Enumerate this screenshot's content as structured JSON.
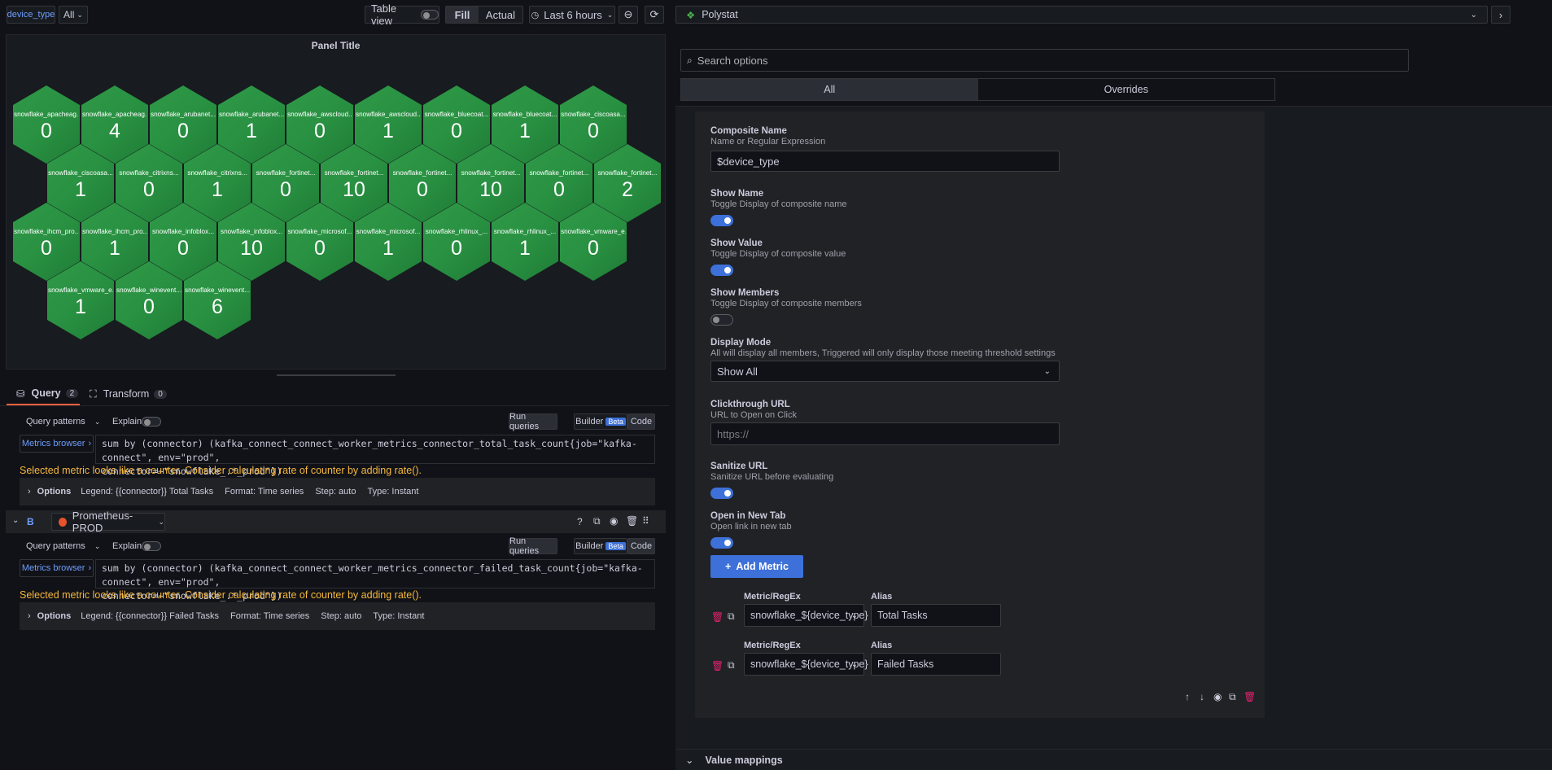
{
  "toolbar": {
    "var_label": "device_type",
    "var_value": "All",
    "table_view": "Table view",
    "fill": "Fill",
    "actual": "Actual",
    "time_range": "Last 6 hours"
  },
  "panel": {
    "title": "Panel Title"
  },
  "hexes": [
    {
      "name": "snowflake_apacheag...",
      "value": "0"
    },
    {
      "name": "snowflake_apacheag...",
      "value": "4"
    },
    {
      "name": "snowflake_arubanet...",
      "value": "0"
    },
    {
      "name": "snowflake_arubanet...",
      "value": "1"
    },
    {
      "name": "snowflake_awscloud...",
      "value": "0"
    },
    {
      "name": "snowflake_awscloud...",
      "value": "1"
    },
    {
      "name": "snowflake_bluecoat...",
      "value": "0"
    },
    {
      "name": "snowflake_bluecoat...",
      "value": "1"
    },
    {
      "name": "snowflake_ciscoasa...",
      "value": "0"
    },
    {
      "name": "snowflake_ciscoasa...",
      "value": "1"
    },
    {
      "name": "snowflake_citrixns...",
      "value": "0"
    },
    {
      "name": "snowflake_citrixns...",
      "value": "1"
    },
    {
      "name": "snowflake_fortinet...",
      "value": "0"
    },
    {
      "name": "snowflake_fortinet...",
      "value": "10"
    },
    {
      "name": "snowflake_fortinet...",
      "value": "0"
    },
    {
      "name": "snowflake_fortinet...",
      "value": "10"
    },
    {
      "name": "snowflake_fortinet...",
      "value": "0"
    },
    {
      "name": "snowflake_fortinet...",
      "value": "2"
    },
    {
      "name": "snowflake_ihcm_pro...",
      "value": "0"
    },
    {
      "name": "snowflake_ihcm_pro...",
      "value": "1"
    },
    {
      "name": "snowflake_infoblox...",
      "value": "0"
    },
    {
      "name": "snowflake_infoblox...",
      "value": "10"
    },
    {
      "name": "snowflake_microsof...",
      "value": "0"
    },
    {
      "name": "snowflake_microsof...",
      "value": "1"
    },
    {
      "name": "snowflake_rhlinux_...",
      "value": "0"
    },
    {
      "name": "snowflake_rhlinux_...",
      "value": "1"
    },
    {
      "name": "snowflake_vmware_e...",
      "value": "0"
    },
    {
      "name": "snowflake_vmware_e...",
      "value": "1"
    },
    {
      "name": "snowflake_winevent...",
      "value": "0"
    },
    {
      "name": "snowflake_winevent...",
      "value": "6"
    }
  ],
  "tabs": {
    "query": "Query",
    "query_count": "2",
    "transform": "Transform",
    "transform_count": "0"
  },
  "queryA": {
    "patterns": "Query patterns",
    "explain": "Explain",
    "run": "Run queries",
    "builder": "Builder",
    "beta": "Beta",
    "code": "Code",
    "metrics_browser": "Metrics browser",
    "expr_1": "sum by (connector) (kafka_connect_connect_worker_metrics_connector_total_task_count{job=\"kafka-connect\", env=\"prod\",",
    "expr_2": "connector=~\"snowflake_.*_prod\"})",
    "warning": "Selected metric looks like a counter. Consider calculating rate of counter by adding rate().",
    "options": "Options",
    "legend": "Legend: {{connector}} Total Tasks",
    "format": "Format: Time series",
    "step": "Step: auto",
    "type": "Type: Instant"
  },
  "queryB": {
    "letter": "B",
    "datasource": "Prometheus-PROD",
    "patterns": "Query patterns",
    "explain": "Explain",
    "run": "Run queries",
    "builder": "Builder",
    "beta": "Beta",
    "code": "Code",
    "metrics_browser": "Metrics browser",
    "expr_1": "sum by (connector) (kafka_connect_connect_worker_metrics_connector_failed_task_count{job=\"kafka-connect\", env=\"prod\",",
    "expr_2": "connector=~\"snowflake_.*_prod\"})",
    "warning": "Selected metric looks like a counter. Consider calculating rate of counter by adding rate().",
    "options": "Options",
    "legend": "Legend: {{connector}} Failed Tasks",
    "format": "Format: Time series",
    "step": "Step: auto",
    "type": "Type: Instant"
  },
  "right": {
    "viz": "Polystat",
    "search_placeholder": "Search options",
    "tab_all": "All",
    "tab_overrides": "Overrides",
    "composite_name": "Composite Name",
    "composite_name_desc": "Name or Regular Expression",
    "composite_name_value": "$device_type",
    "show_name": "Show Name",
    "show_name_desc": "Toggle Display of composite name",
    "show_value": "Show Value",
    "show_value_desc": "Toggle Display of composite value",
    "show_members": "Show Members",
    "show_members_desc": "Toggle Display of composite members",
    "display_mode": "Display Mode",
    "display_mode_desc": "All will display all members, Triggered will only display those meeting threshold settings",
    "display_mode_value": "Show All",
    "clickthrough": "Clickthrough URL",
    "clickthrough_desc": "URL to Open on Click",
    "clickthrough_placeholder": "https://",
    "sanitize": "Sanitize URL",
    "sanitize_desc": "Sanitize URL before evaluating",
    "new_tab": "Open in New Tab",
    "new_tab_desc": "Open link in new tab",
    "add_metric": "Add Metric",
    "metrics": [
      {
        "label": "Metric/RegEx",
        "value": "snowflake_${device_type}",
        "alias_label": "Alias",
        "alias": "Total Tasks"
      },
      {
        "label": "Metric/RegEx",
        "value": "snowflake_${device_type}",
        "alias_label": "Alias",
        "alias": "Failed Tasks"
      }
    ],
    "value_mappings": "Value mappings"
  }
}
